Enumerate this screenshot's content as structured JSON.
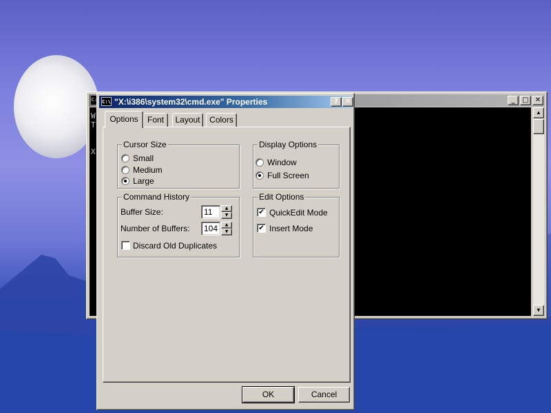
{
  "cmd_window": {
    "icon": "C:\\",
    "console_chars": "W\nT\n\n\nX"
  },
  "dialog": {
    "icon": "C:\\",
    "title": "\"X:\\i386\\system32\\cmd.exe\" Properties",
    "help_button": "?",
    "close_button": "✕"
  },
  "tabs": [
    {
      "label": "Options",
      "active": true
    },
    {
      "label": "Font",
      "active": false
    },
    {
      "label": "Layout",
      "active": false
    },
    {
      "label": "Colors",
      "active": false
    }
  ],
  "cursor_size": {
    "label": "Cursor Size",
    "options": [
      {
        "label": "Small",
        "checked": false
      },
      {
        "label": "Medium",
        "checked": false
      },
      {
        "label": "Large",
        "checked": true
      }
    ]
  },
  "display_options": {
    "label": "Display Options",
    "options": [
      {
        "label": "Window",
        "checked": false
      },
      {
        "label": "Full Screen",
        "checked": true
      }
    ]
  },
  "command_history": {
    "label": "Command History",
    "buffer_size_label": "Buffer Size:",
    "buffer_size_value": "11",
    "num_buffers_label": "Number of Buffers:",
    "num_buffers_value": "104",
    "discard_label": "Discard Old Duplicates",
    "discard_checked": false
  },
  "edit_options": {
    "label": "Edit Options",
    "quickedit_label": "QuickEdit Mode",
    "quickedit_checked": true,
    "insert_label": "Insert Mode",
    "insert_checked": true
  },
  "buttons": {
    "ok": "OK",
    "cancel": "Cancel"
  },
  "glyphs": {
    "check": "✔",
    "spin_up": "▲",
    "spin_down": "▼",
    "minimize": "_",
    "maximize": "□",
    "close": "✕"
  }
}
